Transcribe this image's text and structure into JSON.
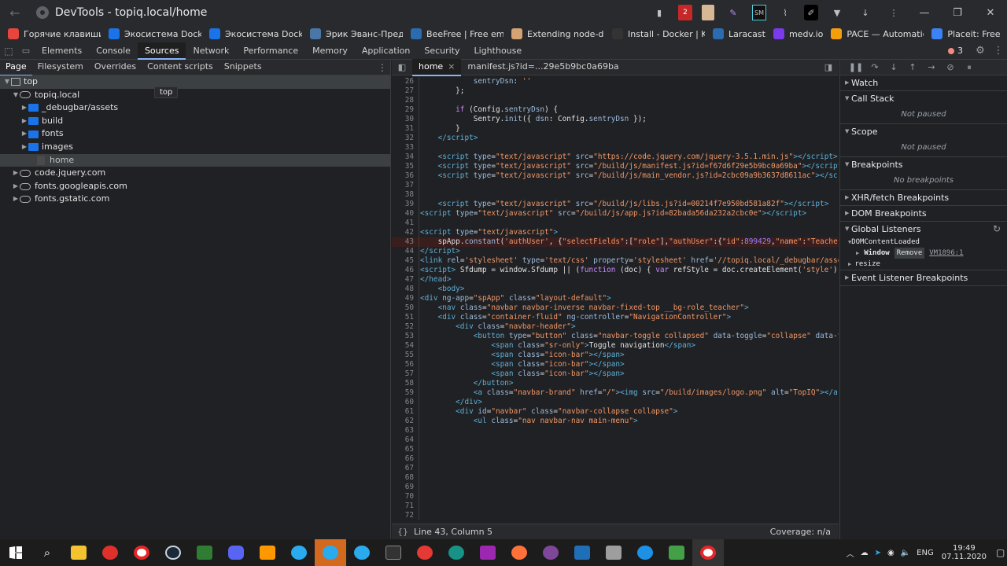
{
  "window": {
    "title": "DevTools - topiq.local/home",
    "badge": "2"
  },
  "bookmarks": [
    {
      "label": "Горячие клавиши",
      "color": "#e8453c"
    },
    {
      "label": "Экосистема Docke",
      "color": "#1a73e8"
    },
    {
      "label": "Экосистема Docke",
      "color": "#1a73e8"
    },
    {
      "label": "Эрик Эванс-Предм",
      "color": "#4a76a8"
    },
    {
      "label": "BeeFree | Free ema",
      "color": "#2b6cb0"
    },
    {
      "label": "Extending node-do",
      "color": "#d4a373"
    },
    {
      "label": "Install - Docker | K",
      "color": "#333333"
    },
    {
      "label": "Laracast",
      "color": "#2b6cb0"
    },
    {
      "label": "medv.io",
      "color": "#7c3aed"
    },
    {
      "label": "PACE — Automatic",
      "color": "#f59e0b"
    },
    {
      "label": "Placeit: Free",
      "color": "#3b82f6"
    }
  ],
  "devtools": {
    "tabs": [
      "Elements",
      "Console",
      "Sources",
      "Network",
      "Performance",
      "Memory",
      "Application",
      "Security",
      "Lighthouse"
    ],
    "active_tab": "Sources",
    "error_count": "3"
  },
  "left": {
    "subtabs": [
      "Page",
      "Filesystem",
      "Overrides",
      "Content scripts",
      "Snippets"
    ],
    "tree": [
      {
        "label": "top",
        "depth": 0,
        "kind": "frame",
        "caret": "▼"
      },
      {
        "label": "topiq.local",
        "depth": 1,
        "kind": "cloud",
        "caret": "▼"
      },
      {
        "label": "_debugbar/assets",
        "depth": 2,
        "kind": "folder",
        "caret": "▶"
      },
      {
        "label": "build",
        "depth": 2,
        "kind": "folder",
        "caret": "▶"
      },
      {
        "label": "fonts",
        "depth": 2,
        "kind": "folder",
        "caret": "▶"
      },
      {
        "label": "images",
        "depth": 2,
        "kind": "folder",
        "caret": "▶"
      },
      {
        "label": "home",
        "depth": 3,
        "kind": "file",
        "caret": ""
      },
      {
        "label": "code.jquery.com",
        "depth": 1,
        "kind": "cloud",
        "caret": "▶"
      },
      {
        "label": "fonts.googleapis.com",
        "depth": 1,
        "kind": "cloud",
        "caret": "▶"
      },
      {
        "label": "fonts.gstatic.com",
        "depth": 1,
        "kind": "cloud",
        "caret": "▶"
      }
    ],
    "tooltip": "top"
  },
  "editor": {
    "tabs": [
      "home",
      "manifest.js?id=...29e5b9bc0a69ba"
    ],
    "active_tab": "home",
    "close_glyph": "×",
    "status": "Line 43, Column 5",
    "coverage": "Coverage: n/a",
    "lines": [
      {
        "n": "26",
        "html": "            <span class='a'>sentryDsn</span><span class='p'>: </span><span class='s'>''</span>"
      },
      {
        "n": "27",
        "html": "        <span class='p'>};</span>"
      },
      {
        "n": "28",
        "html": ""
      },
      {
        "n": "29",
        "html": "        <span class='k'>if</span><span class='p'> (Config.</span><span class='a'>sentryDsn</span><span class='p'>) {</span>"
      },
      {
        "n": "30",
        "html": "            <span class='p'>Sentry.</span><span class='a'>init</span><span class='p'>({ </span><span class='a'>dsn</span><span class='p'>: Config.</span><span class='a'>sentryDsn</span><span class='p'> });</span>"
      },
      {
        "n": "31",
        "html": "        <span class='p'>}</span>"
      },
      {
        "n": "32",
        "html": "    <span class='t'>&lt;/script&gt;</span>"
      },
      {
        "n": "33",
        "html": ""
      },
      {
        "n": "34",
        "html": "    <span class='t'>&lt;script</span> <span class='a'>type</span><span class='p'>=</span><span class='s'>\"text/javascript\"</span> <span class='a'>src</span><span class='p'>=</span><span class='s'>\"https://code.jquery.com/jquery-3.5.1.min.js\"</span><span class='t'>&gt;&lt;/script&gt;</span>"
      },
      {
        "n": "35",
        "html": "    <span class='t'>&lt;script</span> <span class='a'>type</span><span class='p'>=</span><span class='s'>\"text/javascript\"</span> <span class='a'>src</span><span class='p'>=</span><span class='s'>\"/build/js/manifest.js?id=f67d6f29e5b9bc0a69ba\"</span><span class='t'>&gt;&lt;/script&gt;</span>"
      },
      {
        "n": "36",
        "html": "    <span class='t'>&lt;script</span> <span class='a'>type</span><span class='p'>=</span><span class='s'>\"text/javascript\"</span> <span class='a'>src</span><span class='p'>=</span><span class='s'>\"/build/js/main_vendor.js?id=2cbc09a9b3637d8611ac\"</span><span class='t'>&gt;&lt;/scr</span>"
      },
      {
        "n": "37",
        "html": ""
      },
      {
        "n": "38",
        "html": ""
      },
      {
        "n": "39",
        "html": "    <span class='t'>&lt;script</span> <span class='a'>type</span><span class='p'>=</span><span class='s'>\"text/javascript\"</span> <span class='a'>src</span><span class='p'>=</span><span class='s'>\"/build/js/libs.js?id=00214f7e950bd581a82f\"</span><span class='t'>&gt;&lt;/script&gt;</span>"
      },
      {
        "n": "40",
        "html": "<span class='t'>&lt;script</span> <span class='a'>type</span><span class='p'>=</span><span class='s'>\"text/javascript\"</span> <span class='a'>src</span><span class='p'>=</span><span class='s'>\"/build/js/app.js?id=82bada56da232a2cbc0e\"</span><span class='t'>&gt;&lt;/script&gt;</span>"
      },
      {
        "n": "41",
        "html": ""
      },
      {
        "n": "42",
        "html": "<span class='t'>&lt;script</span> <span class='a'>type</span><span class='p'>=</span><span class='s'>\"text/javascript\"</span><span class='t'>&gt;</span>"
      },
      {
        "n": "43",
        "html": "    <span class='p'>spApp.</span><span class='a'>constant</span><span class='p'>(</span><span class='s'>'authUser'</span><span class='p'>, {</span><span class='s'>\"selectFields\"</span><span class='p'>:[</span><span class='s'>\"role\"</span><span class='p'>],</span><span class='s'>\"authUser\"</span><span class='p'>:{</span><span class='s'>\"id\"</span><span class='p'>:</span><span class='n'>899429</span><span class='p'>,</span><span class='s'>\"name\"</span><span class='p'>:</span><span class='s'>\"Teacher</span>",
        "hl": true
      },
      {
        "n": "44",
        "html": "<span class='t'>&lt;/script&gt;</span>"
      },
      {
        "n": "45",
        "html": "<span class='t'>&lt;link</span> <span class='a'>rel</span><span class='p'>=</span><span class='s'>'stylesheet'</span> <span class='a'>type</span><span class='p'>=</span><span class='s'>'text/css'</span> <span class='a'>property</span><span class='p'>=</span><span class='s'>'stylesheet'</span> <span class='a'>href</span><span class='p'>=</span><span class='s'>'//topiq.local/_debugbar/asse</span>"
      },
      {
        "n": "46",
        "html": "<span class='t'>&lt;script&gt;</span> <span class='p'>Sfdump = window.Sfdump || (</span><span class='k'>function</span><span class='p'> (doc) { </span><span class='k'>var</span><span class='p'> refStyle = doc.createElement(</span><span class='s'>'style'</span><span class='p'>),</span>"
      },
      {
        "n": "47",
        "html": "<span class='t'>&lt;/head&gt;</span>"
      },
      {
        "n": "48",
        "html": "    <span class='t'>&lt;body&gt;</span>"
      },
      {
        "n": "49",
        "html": "<span class='t'>&lt;div</span> <span class='a'>ng-app</span><span class='p'>=</span><span class='s'>\"spApp\"</span> <span class='a'>class</span><span class='p'>=</span><span class='s'>\"layout-default\"</span><span class='t'>&gt;</span>"
      },
      {
        "n": "50",
        "html": "    <span class='t'>&lt;nav</span> <span class='a'>class</span><span class='p'>=</span><span class='s'>\"navbar navbar-inverse navbar-fixed-top __bg-role_teacher\"</span><span class='t'>&gt;</span>"
      },
      {
        "n": "51",
        "html": "    <span class='t'>&lt;div</span> <span class='a'>class</span><span class='p'>=</span><span class='s'>\"container-fluid\"</span> <span class='a'>ng-controller</span><span class='p'>=</span><span class='s'>\"NavigationController\"</span><span class='t'>&gt;</span>"
      },
      {
        "n": "52",
        "html": "        <span class='t'>&lt;div</span> <span class='a'>class</span><span class='p'>=</span><span class='s'>\"navbar-header\"</span><span class='t'>&gt;</span>"
      },
      {
        "n": "53",
        "html": "            <span class='t'>&lt;button</span> <span class='a'>type</span><span class='p'>=</span><span class='s'>\"button\"</span> <span class='a'>class</span><span class='p'>=</span><span class='s'>\"navbar-toggle collapsed\"</span> <span class='a'>data-toggle</span><span class='p'>=</span><span class='s'>\"collapse\"</span> <span class='a'>data-t</span>"
      },
      {
        "n": "54",
        "html": "                <span class='t'>&lt;span</span> <span class='a'>class</span><span class='p'>=</span><span class='s'>\"sr-only\"</span><span class='t'>&gt;</span><span class='p'>Toggle navigation</span><span class='t'>&lt;/span&gt;</span>"
      },
      {
        "n": "55",
        "html": "                <span class='t'>&lt;span</span> <span class='a'>class</span><span class='p'>=</span><span class='s'>\"icon-bar\"</span><span class='t'>&gt;&lt;/span&gt;</span>"
      },
      {
        "n": "56",
        "html": "                <span class='t'>&lt;span</span> <span class='a'>class</span><span class='p'>=</span><span class='s'>\"icon-bar\"</span><span class='t'>&gt;&lt;/span&gt;</span>"
      },
      {
        "n": "57",
        "html": "                <span class='t'>&lt;span</span> <span class='a'>class</span><span class='p'>=</span><span class='s'>\"icon-bar\"</span><span class='t'>&gt;&lt;/span&gt;</span>"
      },
      {
        "n": "58",
        "html": "            <span class='t'>&lt;/button&gt;</span>"
      },
      {
        "n": "59",
        "html": "            <span class='t'>&lt;a</span> <span class='a'>class</span><span class='p'>=</span><span class='s'>\"navbar-brand\"</span> <span class='a'>href</span><span class='p'>=</span><span class='s'>\"/\"</span><span class='t'>&gt;&lt;img</span> <span class='a'>src</span><span class='p'>=</span><span class='s'>\"/build/images/logo.png\"</span> <span class='a'>alt</span><span class='p'>=</span><span class='s'>\"TopIQ\"</span><span class='t'>&gt;&lt;/a:</span>"
      },
      {
        "n": "60",
        "html": "        <span class='t'>&lt;/div&gt;</span>"
      },
      {
        "n": "61",
        "html": "        <span class='t'>&lt;div</span> <span class='a'>id</span><span class='p'>=</span><span class='s'>\"navbar\"</span> <span class='a'>class</span><span class='p'>=</span><span class='s'>\"navbar-collapse collapse\"</span><span class='t'>&gt;</span>"
      },
      {
        "n": "62",
        "html": "            <span class='t'>&lt;ul</span> <span class='a'>class</span><span class='p'>=</span><span class='s'>\"nav navbar-nav main-menu\"</span><span class='t'>&gt;</span>"
      },
      {
        "n": "63",
        "html": ""
      },
      {
        "n": "64",
        "html": ""
      },
      {
        "n": "65",
        "html": ""
      },
      {
        "n": "66",
        "html": ""
      },
      {
        "n": "67",
        "html": ""
      },
      {
        "n": "68",
        "html": ""
      },
      {
        "n": "69",
        "html": ""
      },
      {
        "n": "70",
        "html": ""
      },
      {
        "n": "71",
        "html": ""
      },
      {
        "n": "72",
        "html": ""
      }
    ]
  },
  "right": {
    "sections": [
      {
        "label": "Watch",
        "body": ""
      },
      {
        "label": "Call Stack",
        "body": "Not paused"
      },
      {
        "label": "Scope",
        "body": "Not paused"
      },
      {
        "label": "Breakpoints",
        "body": "No breakpoints"
      },
      {
        "label": "XHR/fetch Breakpoints",
        "body": ""
      },
      {
        "label": "DOM Breakpoints",
        "body": ""
      }
    ],
    "global_listeners": "Global Listeners",
    "listener_event": "DOMContentLoaded",
    "listener_target": "Window",
    "listener_remove": "Remove",
    "listener_source": "VM1896:1",
    "listener_resize": "resize",
    "event_listener_bp": "Event Listener Breakpoints"
  },
  "taskbar": {
    "lang": "ENG",
    "time": "19:49",
    "date": "07.11.2020"
  }
}
